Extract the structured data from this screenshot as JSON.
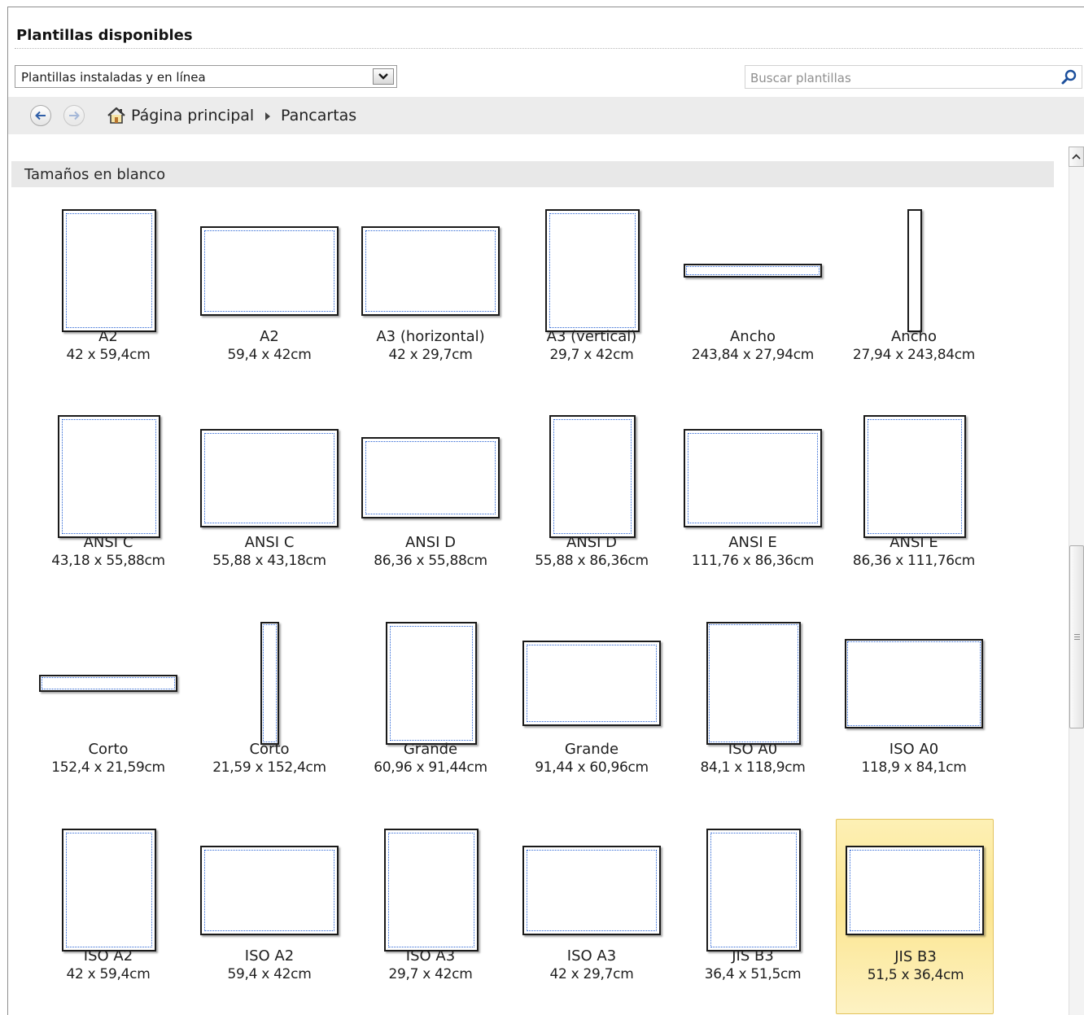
{
  "header": {
    "title": "Plantillas disponibles"
  },
  "filter": {
    "selected": "Plantillas instaladas y en línea"
  },
  "search": {
    "placeholder": "Buscar plantillas"
  },
  "breadcrumb": {
    "home": "Página principal",
    "current": "Pancartas"
  },
  "section": {
    "label": "Tamaños en blanco"
  },
  "colors": {
    "accent_border": "#2a64d4",
    "selection": "#fce58f"
  },
  "templates": [
    {
      "name": "A2",
      "size": "42 x 59,4cm"
    },
    {
      "name": "A2",
      "size": "59,4 x 42cm"
    },
    {
      "name": "A3 (horizontal)",
      "size": "42 x 29,7cm"
    },
    {
      "name": "A3 (vertical)",
      "size": "29,7 x 42cm"
    },
    {
      "name": "Ancho",
      "size": "243,84 x 27,94cm"
    },
    {
      "name": "Ancho",
      "size": "27,94 x 243,84cm"
    },
    {
      "name": "ANSI C",
      "size": "43,18 x 55,88cm"
    },
    {
      "name": "ANSI C",
      "size": "55,88 x 43,18cm"
    },
    {
      "name": "ANSI D",
      "size": "86,36 x 55,88cm"
    },
    {
      "name": "ANSI D",
      "size": "55,88 x 86,36cm"
    },
    {
      "name": "ANSI E",
      "size": "111,76 x 86,36cm"
    },
    {
      "name": "ANSI E",
      "size": "86,36 x 111,76cm"
    },
    {
      "name": "Corto",
      "size": "152,4 x 21,59cm"
    },
    {
      "name": "Corto",
      "size": "21,59 x 152,4cm"
    },
    {
      "name": "Grande",
      "size": "60,96 x 91,44cm"
    },
    {
      "name": "Grande",
      "size": "91,44 x 60,96cm"
    },
    {
      "name": "ISO A0",
      "size": "84,1 x 118,9cm"
    },
    {
      "name": "ISO A0",
      "size": "118,9 x 84,1cm"
    },
    {
      "name": "ISO A2",
      "size": "42 x 59,4cm"
    },
    {
      "name": "ISO A2",
      "size": "59,4 x 42cm"
    },
    {
      "name": "ISO A3",
      "size": "29,7 x 42cm"
    },
    {
      "name": "ISO A3",
      "size": "42 x 29,7cm"
    },
    {
      "name": "JIS B3",
      "size": "36,4 x 51,5cm"
    },
    {
      "name": "JIS B3",
      "size": "51,5 x 36,4cm"
    }
  ]
}
